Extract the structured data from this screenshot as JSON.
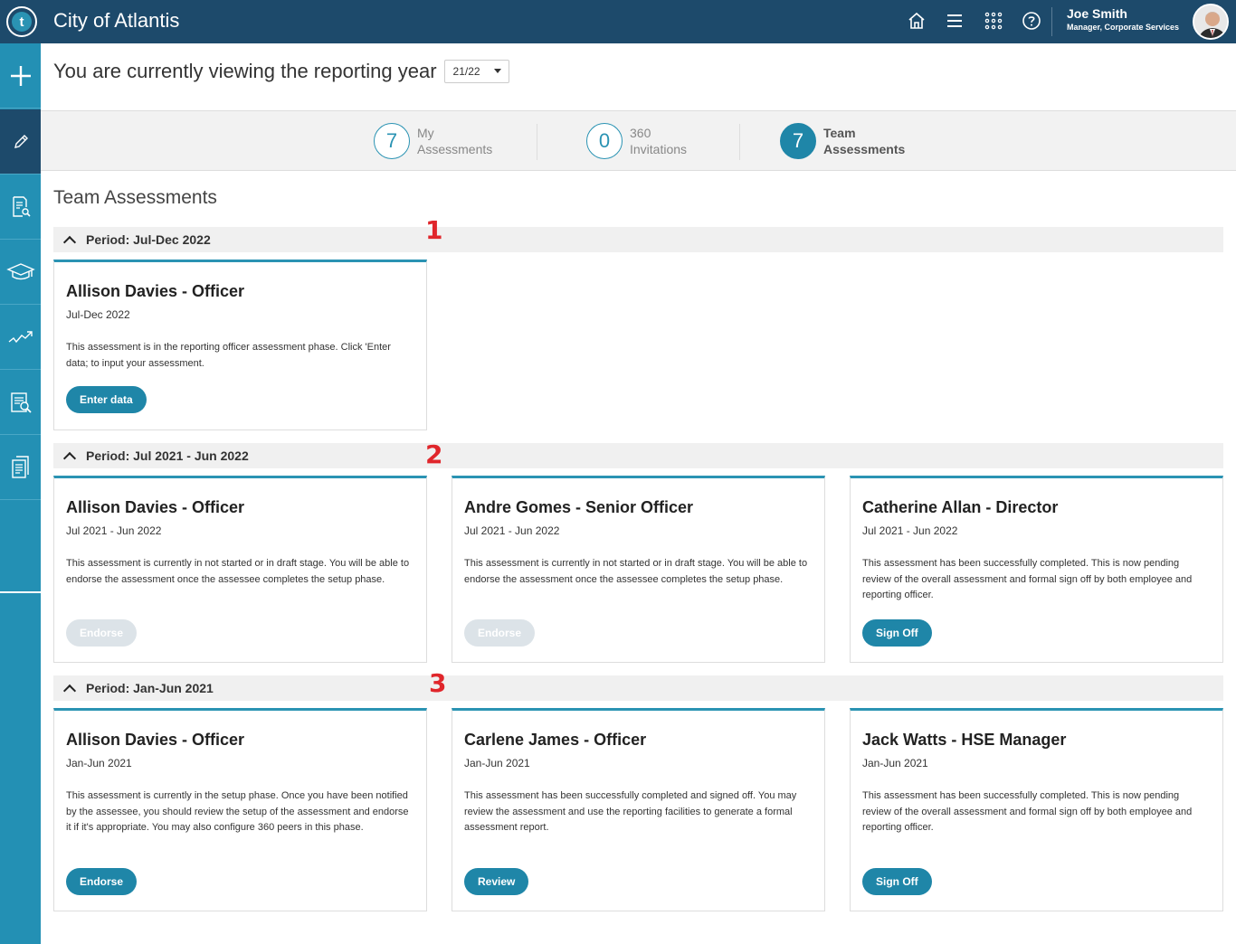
{
  "app": {
    "title": "City of Atlantis",
    "logo_letter": "t"
  },
  "user": {
    "name": "Joe Smith",
    "role": "Manager, Corporate Services"
  },
  "topbar_icons": [
    "home-icon",
    "menu-icon",
    "apps-grid-icon",
    "help-icon"
  ],
  "sidebar": {
    "items": [
      "add-icon",
      "pencil-icon",
      "document-search-icon",
      "graduation-cap-icon",
      "trend-icon",
      "report-search-icon",
      "documents-icon"
    ]
  },
  "reporting_year": {
    "label": "You are currently viewing the reporting year",
    "value": "21/22"
  },
  "tabs": [
    {
      "count": "7",
      "line1": "My",
      "line2": "Assessments",
      "active": false
    },
    {
      "count": "0",
      "line1": "360",
      "line2": "Invitations",
      "active": false
    },
    {
      "count": "7",
      "line1": "Team",
      "line2": "Assessments",
      "active": true
    }
  ],
  "section_title": "Team Assessments",
  "periods": [
    {
      "label": "Period: Jul-Dec 2022",
      "marker": "1",
      "cards": [
        {
          "title": "Allison Davies - Officer",
          "period": "Jul-Dec 2022",
          "desc": "This assessment is in the reporting officer assessment phase. Click 'Enter data; to input your assessment.",
          "button": "Enter data",
          "button_enabled": true
        }
      ]
    },
    {
      "label": "Period: Jul 2021 - Jun 2022",
      "marker": "2",
      "cards": [
        {
          "title": "Allison Davies - Officer",
          "period": "Jul 2021 - Jun 2022",
          "desc": "This assessment is currently in not started or in draft stage. You will be able to endorse the assessment once the assessee completes the setup phase.",
          "button": "Endorse",
          "button_enabled": false
        },
        {
          "title": "Andre Gomes - Senior Officer",
          "period": "Jul 2021 - Jun 2022",
          "desc": "This assessment is currently in not started or in draft stage. You will be able to endorse the assessment once the assessee completes the setup phase.",
          "button": "Endorse",
          "button_enabled": false
        },
        {
          "title": "Catherine Allan - Director",
          "period": "Jul 2021 - Jun 2022",
          "desc": "This assessment has been successfully completed. This is now pending review of the overall assessment and formal sign off by both employee and reporting officer.",
          "button": "Sign Off",
          "button_enabled": true
        }
      ]
    },
    {
      "label": "Period: Jan-Jun 2021",
      "marker": "3",
      "cards": [
        {
          "title": "Allison Davies - Officer",
          "period": "Jan-Jun 2021",
          "desc": "This assessment is currently in the setup phase. Once you have been notified by the assessee, you should review the setup of the assessment and endorse it if it's appropriate. You may also configure 360 peers in this phase.",
          "button": "Endorse",
          "button_enabled": true
        },
        {
          "title": "Carlene James - Officer",
          "period": "Jan-Jun 2021",
          "desc": "This assessment has been successfully completed and signed off. You may review the assessment and use the reporting facilities to generate a formal assessment report.",
          "button": "Review",
          "button_enabled": true
        },
        {
          "title": "Jack Watts - HSE Manager",
          "period": "Jan-Jun 2021",
          "desc": "This assessment has been successfully completed. This is now pending review of the overall assessment and formal sign off by both employee and reporting officer.",
          "button": "Sign Off",
          "button_enabled": true
        }
      ]
    }
  ]
}
